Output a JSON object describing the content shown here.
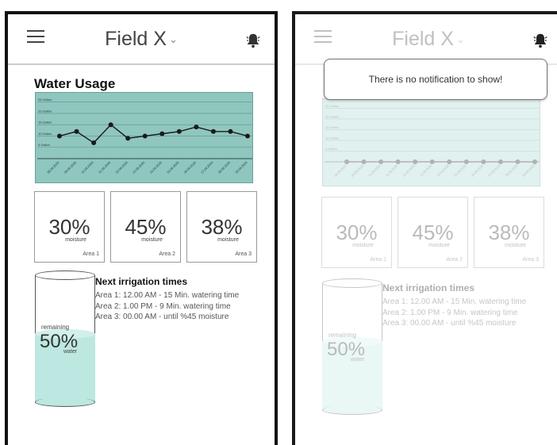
{
  "screens": [
    {
      "header": {
        "title": "Field X",
        "chevron": "⌄",
        "menu_icon": "hamburger-menu-icon",
        "notification_icon": "bell-icon"
      },
      "section_title": "Water Usage",
      "chart_data": {
        "type": "line",
        "y_tick_labels": [
          "25 Gallon",
          "20 Gallon",
          "15 Gallon",
          "10 Gallon",
          "5 Gallon"
        ],
        "y_ticks": [
          25,
          20,
          15,
          10,
          5
        ],
        "ylim": [
          0,
          27
        ],
        "x_tick_labels": [
          "08.06.2020",
          "09.06.2020",
          "10.06.2020",
          "11.06.2020",
          "12.06.2020",
          "13.06.2020",
          "14.06.2020",
          "15.06.2020",
          "16.06.2020",
          "17.06.2020",
          "18.06.2020",
          "19.06.2020"
        ],
        "series": [
          {
            "values": [
              10,
              12,
              7,
              15,
              9,
              10,
              11,
              12,
              14,
              12,
              12,
              10
            ]
          }
        ],
        "grid": true,
        "colors": {
          "background": "#8fc7be",
          "line": "#1a1a1a",
          "grid": "#5a8f87"
        }
      },
      "tiles": [
        {
          "percent": "30%",
          "label": "moisture",
          "area": "Area 1"
        },
        {
          "percent": "45%",
          "label": "moisture",
          "area": "Area 2"
        },
        {
          "percent": "38%",
          "label": "moisture",
          "area": "Area 3"
        }
      ],
      "tank": {
        "label": "remaining",
        "percent": "50%",
        "sub": "water",
        "level": 0.5
      },
      "irrigation": {
        "title": "Next irrigation times",
        "lines": [
          "Area 1: 12.00 AM - 15 Min. watering time",
          "Area 2: 1.00 PM - 9 Min. watering time",
          "Area 3: 00.00 AM - until %45 moisture"
        ]
      }
    },
    {
      "header": {
        "title": "Field X",
        "chevron": "⌄",
        "menu_icon": "hamburger-menu-icon",
        "notification_icon": "bell-icon"
      },
      "popup": {
        "message": "There is no notification to show!"
      },
      "chart_data": {
        "type": "line",
        "y_tick_labels": [
          "25 Gallon",
          "20 Gallon",
          "15 Gallon",
          "10 Gallon",
          "5 Gallon"
        ],
        "y_ticks": [
          25,
          20,
          15,
          10,
          5
        ],
        "ylim": [
          0,
          27
        ],
        "x_tick_labels": [
          "08.06.2020",
          "09.06.2020",
          "10.06.2020",
          "11.06.2020",
          "12.06.2020",
          "13.06.2020",
          "14.06.2020",
          "15.06.2020",
          "16.06.2020",
          "17.06.2020",
          "18.06.2020",
          "19.06.2020"
        ],
        "series": [
          {
            "values": [
              0,
              0,
              0,
              0,
              0,
              0,
              0,
              0,
              0,
              0,
              0,
              0
            ]
          }
        ],
        "grid": true,
        "colors": {
          "background": "#a4d6ce",
          "line": "#1a1a1a",
          "grid": "#5a8f87"
        }
      },
      "tiles": [
        {
          "percent": "30%",
          "label": "moisture",
          "area": "Area 1"
        },
        {
          "percent": "45%",
          "label": "moisture",
          "area": "Area 2"
        },
        {
          "percent": "38%",
          "label": "moisture",
          "area": "Area 3"
        }
      ],
      "tank": {
        "label": "remaining",
        "percent": "50%",
        "sub": "water",
        "level": 0.5
      },
      "irrigation": {
        "title": "Next irrigation times",
        "lines": [
          "Area 1: 12.00 AM - 15 Min. watering time",
          "Area 2: 1.00 PM - 9 Min. watering time",
          "Area 3: 00.00 AM - until %45 moisture"
        ]
      }
    }
  ]
}
